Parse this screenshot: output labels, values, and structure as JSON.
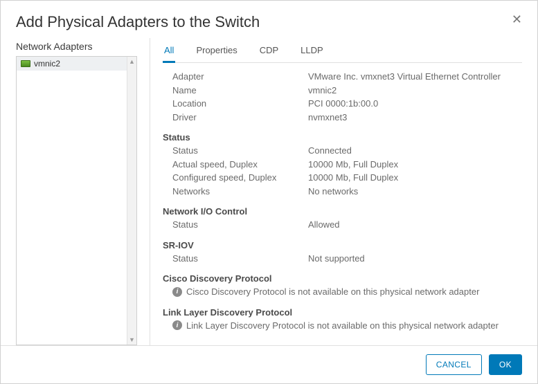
{
  "dialog": {
    "title": "Add Physical Adapters to the Switch",
    "close_glyph": "✕"
  },
  "left": {
    "label": "Network Adapters",
    "items": [
      {
        "name": "vmnic2"
      }
    ],
    "scroll_up": "▲",
    "scroll_down": "▼"
  },
  "tabs": [
    {
      "label": "All",
      "active": true
    },
    {
      "label": "Properties",
      "active": false
    },
    {
      "label": "CDP",
      "active": false
    },
    {
      "label": "LLDP",
      "active": false
    }
  ],
  "details": {
    "general": [
      {
        "k": "Adapter",
        "v": "VMware Inc. vmxnet3 Virtual Ethernet Controller"
      },
      {
        "k": "Name",
        "v": "vmnic2"
      },
      {
        "k": "Location",
        "v": "PCI 0000:1b:00.0"
      },
      {
        "k": "Driver",
        "v": "nvmxnet3"
      }
    ],
    "status_head": "Status",
    "status": [
      {
        "k": "Status",
        "v": "Connected"
      },
      {
        "k": "Actual speed, Duplex",
        "v": "10000 Mb, Full Duplex"
      },
      {
        "k": "Configured speed, Duplex",
        "v": "10000 Mb, Full Duplex"
      },
      {
        "k": "Networks",
        "v": "No networks"
      }
    ],
    "nioc_head": "Network I/O Control",
    "nioc": [
      {
        "k": "Status",
        "v": "Allowed"
      }
    ],
    "sriov_head": "SR-IOV",
    "sriov": [
      {
        "k": "Status",
        "v": "Not supported"
      }
    ],
    "cdp_head": "Cisco Discovery Protocol",
    "cdp_msg": "Cisco Discovery Protocol is not available on this physical network adapter",
    "lldp_head": "Link Layer Discovery Protocol",
    "lldp_msg": "Link Layer Discovery Protocol is not available on this physical network adapter"
  },
  "footer": {
    "cancel": "CANCEL",
    "ok": "OK"
  }
}
